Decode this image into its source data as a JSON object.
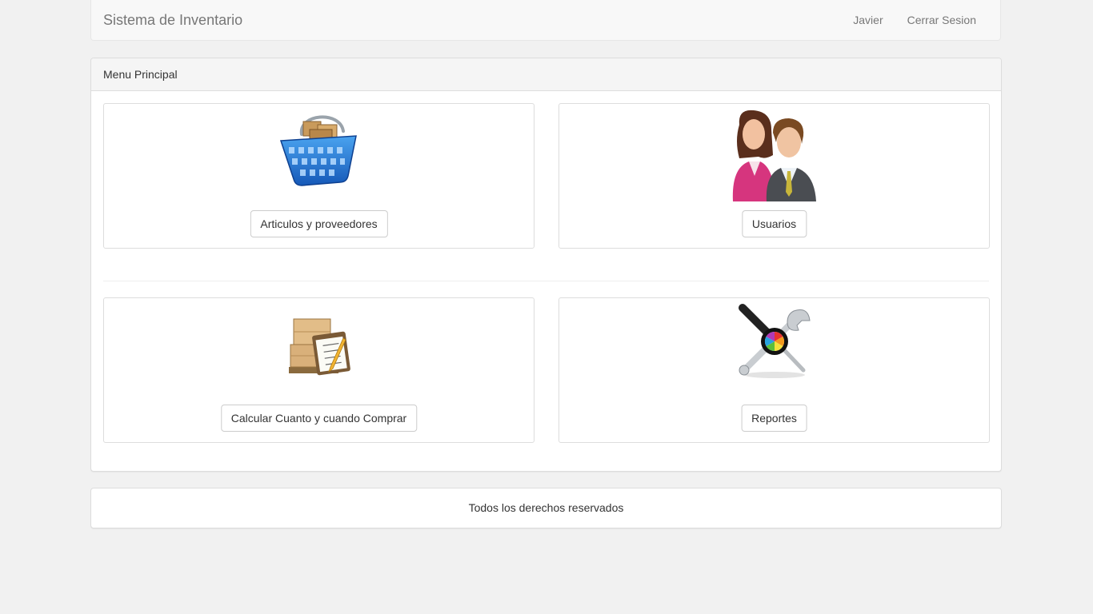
{
  "navbar": {
    "brand": "Sistema de Inventario",
    "user": "Javier",
    "logout": "Cerrar Sesion"
  },
  "panel": {
    "heading": "Menu Principal",
    "cards": [
      {
        "label": "Articulos y proveedores",
        "icon": "shopping-basket-icon"
      },
      {
        "label": "Usuarios",
        "icon": "users-icon"
      },
      {
        "label": "Calcular Cuanto y cuando Comprar",
        "icon": "boxes-clipboard-icon"
      },
      {
        "label": "Reportes",
        "icon": "tools-color-wheel-icon"
      }
    ]
  },
  "footer": {
    "text": "Todos los derechos reservados"
  }
}
